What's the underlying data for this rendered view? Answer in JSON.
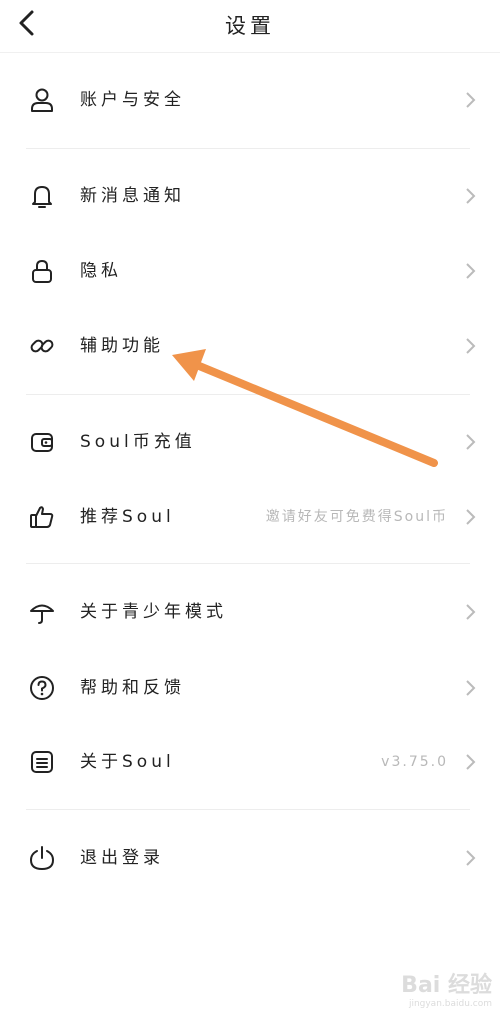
{
  "header": {
    "title": "设置",
    "back_icon": "chevron-left-icon"
  },
  "groups": [
    {
      "items": [
        {
          "label": "账户与安全",
          "icon": "user-icon"
        }
      ]
    },
    {
      "items": [
        {
          "label": "新消息通知",
          "icon": "bell-icon"
        },
        {
          "label": "隐私",
          "icon": "lock-icon"
        },
        {
          "label": "辅助功能",
          "icon": "link-icon"
        }
      ]
    },
    {
      "items": [
        {
          "label": "Soul币充值",
          "icon": "wallet-icon"
        },
        {
          "label": "推荐Soul",
          "icon": "thumbs-up-icon",
          "hint": "邀请好友可免费得Soul币"
        }
      ]
    },
    {
      "items": [
        {
          "label": "关于青少年模式",
          "icon": "umbrella-icon"
        },
        {
          "label": "帮助和反馈",
          "icon": "help-icon"
        },
        {
          "label": "关于Soul",
          "icon": "document-icon",
          "hint": "v3.75.0"
        }
      ]
    },
    {
      "items": [
        {
          "label": "退出登录",
          "icon": "power-icon"
        }
      ]
    }
  ],
  "annotation": {
    "color": "#f0934a"
  },
  "watermark": {
    "main": "Bai 经验",
    "sub": "jingyan.baidu.com"
  }
}
